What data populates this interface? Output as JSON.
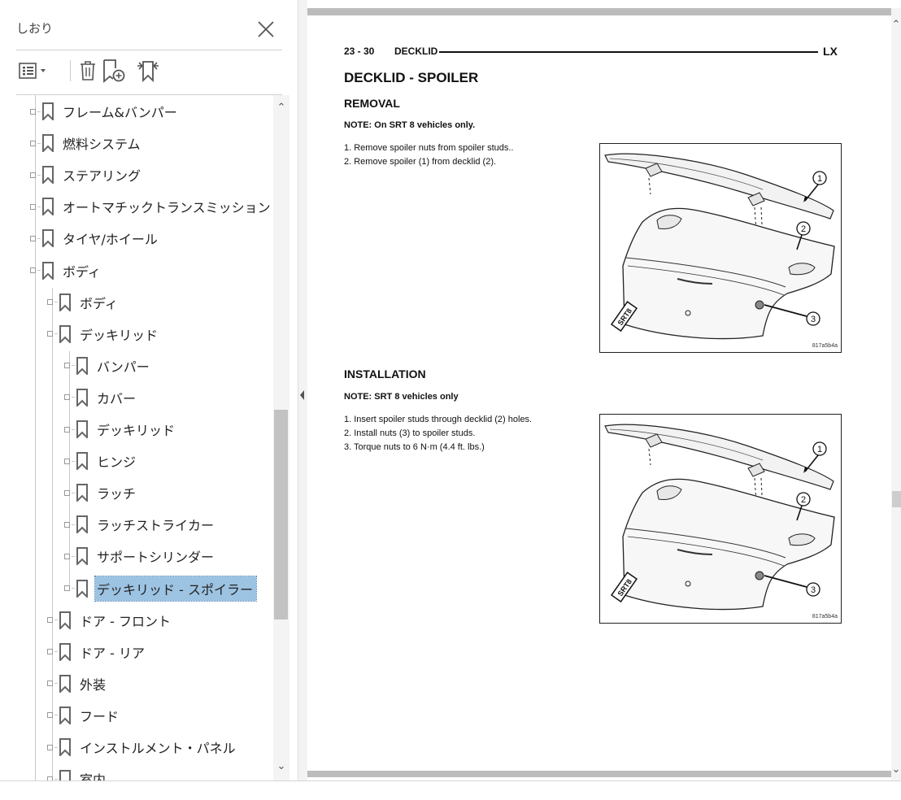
{
  "bookmarks_panel": {
    "title": "しおり",
    "close_icon": "close-icon",
    "toolbar": {
      "options_icon": "bookmark-options-icon",
      "delete_icon": "trash-icon",
      "new_bookmark_icon": "new-bookmark-icon",
      "find_current_icon": "find-current-bookmark-icon"
    },
    "items": [
      {
        "label": "フレーム&バンパー",
        "level": 0
      },
      {
        "label": "燃料システム",
        "level": 0
      },
      {
        "label": "ステアリング",
        "level": 0
      },
      {
        "label": "オートマチックトランスミッション",
        "level": 0
      },
      {
        "label": "タイヤ/ホイール",
        "level": 0
      },
      {
        "label": "ボディ",
        "level": 0
      },
      {
        "label": "ボディ",
        "level": 1
      },
      {
        "label": "デッキリッド",
        "level": 1
      },
      {
        "label": "バンパー",
        "level": 2
      },
      {
        "label": "カバー",
        "level": 2
      },
      {
        "label": "デッキリッド",
        "level": 2
      },
      {
        "label": "ヒンジ",
        "level": 2
      },
      {
        "label": "ラッチ",
        "level": 2
      },
      {
        "label": "ラッチストライカー",
        "level": 2
      },
      {
        "label": "サポートシリンダー",
        "level": 2
      },
      {
        "label": "デッキリッド - スポイラー",
        "level": 2,
        "selected": true
      },
      {
        "label": "ドア - フロント",
        "level": 1
      },
      {
        "label": "ドア - リア",
        "level": 1
      },
      {
        "label": "外装",
        "level": 1
      },
      {
        "label": "フード",
        "level": 1
      },
      {
        "label": "インストルメント・パネル",
        "level": 1
      },
      {
        "label": "室内",
        "level": 1
      }
    ]
  },
  "document": {
    "header_left": "23 - 30",
    "header_title": "DECKLID",
    "header_right": "LX",
    "title": "DECKLID - SPOILER",
    "removal": {
      "heading": "REMOVAL",
      "note": "NOTE: On SRT 8 vehicles only.",
      "steps": [
        "1. Remove spoiler nuts from spoiler studs..",
        "2. Remove spoiler (1) from decklid (2)."
      ],
      "figure_id": "817a5b4a"
    },
    "installation": {
      "heading": "INSTALLATION",
      "note": "NOTE: SRT 8 vehicles only",
      "steps": [
        "1. Insert spoiler studs through decklid (2) holes.",
        "2. Install nuts (3) to spoiler studs.",
        "3. Torque nuts to 6 N·m (4.4 ft. lbs.)"
      ],
      "figure_id": "817a5b4a"
    },
    "figure_callouts": [
      "1",
      "2",
      "3"
    ],
    "figure_badge": "SRT8"
  },
  "colors": {
    "selection": "#9dc3e2",
    "scrollbar_thumb": "#c2c2c2",
    "page_border": "#bcbcbc"
  }
}
